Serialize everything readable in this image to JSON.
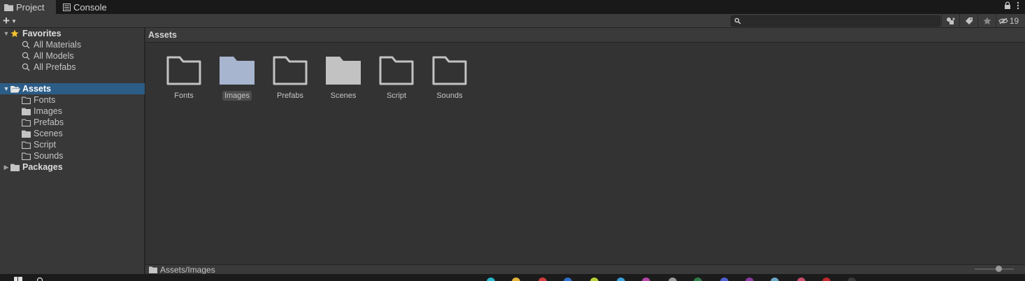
{
  "tabs": [
    {
      "label": "Project",
      "icon": "folder-icon",
      "active": true
    },
    {
      "label": "Console",
      "icon": "console-icon",
      "active": false
    }
  ],
  "toolbar": {
    "add_label": "+",
    "search_placeholder": "",
    "hidden_count": "19"
  },
  "tree": {
    "favorites": {
      "label": "Favorites",
      "items": [
        "All Materials",
        "All Models",
        "All Prefabs"
      ]
    },
    "assets": {
      "label": "Assets",
      "items": [
        "Fonts",
        "Images",
        "Prefabs",
        "Scenes",
        "Script",
        "Sounds"
      ]
    },
    "packages": {
      "label": "Packages"
    }
  },
  "main": {
    "header": "Assets",
    "items": [
      {
        "label": "Fonts",
        "style": "outline"
      },
      {
        "label": "Images",
        "style": "filled-blue"
      },
      {
        "label": "Prefabs",
        "style": "outline"
      },
      {
        "label": "Scenes",
        "style": "filled-gray"
      },
      {
        "label": "Script",
        "style": "outline"
      },
      {
        "label": "Sounds",
        "style": "outline"
      }
    ],
    "selected": "Images",
    "status_path": "Assets/Images"
  },
  "colors": {
    "selection": "#2c5d87",
    "folder_outline": "#c2c2c2",
    "folder_blue": "#a8b5cf",
    "favorite_star": "#f2c230"
  }
}
